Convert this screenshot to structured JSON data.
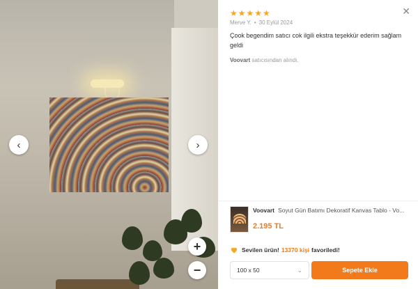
{
  "review": {
    "stars": "★★★★★",
    "author": "Merve Y.",
    "date": "30 Eylül 2024",
    "comment": "Çook begendim satıcı cok ilgili ekstra teşekkür ederim sağlam geldi",
    "seller_name": "Voovart",
    "seller_suffix": "satıcısından alındı."
  },
  "controls": {
    "close": "✕",
    "prev": "‹",
    "next": "›",
    "zoom_in": "+",
    "zoom_out": "−"
  },
  "product": {
    "brand": "Voovart",
    "title": "Soyut Gün Batımı Dekoratif Kanvas Tablo - Vo...",
    "price": "2.195 TL"
  },
  "favorites": {
    "label": "Sevilen ürün!",
    "count": "13370 kişi",
    "suffix": "favoriledi!"
  },
  "size_select": {
    "value": "100 x 50",
    "chevron": "⌄"
  },
  "cart_button": "Sepete Ekle",
  "colors": {
    "accent": "#f27a1a",
    "star": "#f5a623"
  }
}
